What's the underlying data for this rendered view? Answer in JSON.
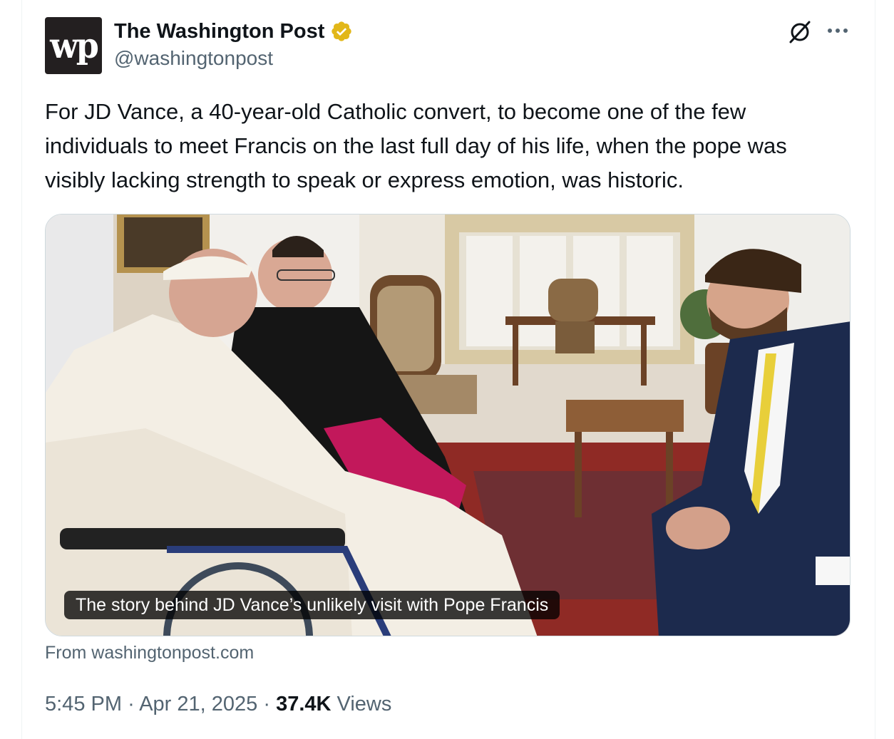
{
  "account": {
    "logo_text": "wp",
    "display_name": "The Washington Post",
    "handle": "@washingtonpost",
    "verified": true,
    "verified_color": "#e2b719"
  },
  "header_icons": [
    "grok-icon",
    "more-icon"
  ],
  "tweet": {
    "text": "For JD Vance, a 40-year-old Catholic convert, to become one of the few individuals to meet Francis on the last full day of his life, when the pope was visibly lacking strength to speak or express emotion, was historic."
  },
  "link_card": {
    "caption": "The story behind JD Vance’s unlikely visit with Pope Francis",
    "source": "From washingtonpost.com"
  },
  "meta": {
    "time": "5:45 PM",
    "separator": "·",
    "date": "Apr 21, 2025",
    "views_count": "37.4K",
    "views_label": "Views"
  },
  "colors": {
    "text_primary": "#0f1419",
    "text_secondary": "#536471",
    "border": "#cfd9de"
  }
}
